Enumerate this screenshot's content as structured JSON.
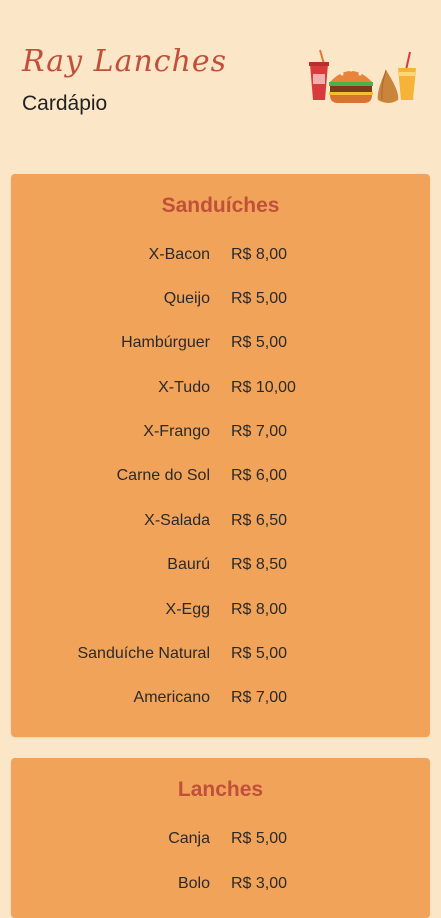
{
  "header": {
    "title": "Ray Lanches",
    "subtitle": "Cardápio",
    "logo_icon": "snack-food-icon"
  },
  "sections": [
    {
      "title": "Sanduíches",
      "items": [
        {
          "name": "X-Bacon",
          "price": "R$ 8,00"
        },
        {
          "name": "Queijo",
          "price": "R$ 5,00"
        },
        {
          "name": "Hambúrguer",
          "price": "R$ 5,00"
        },
        {
          "name": "X-Tudo",
          "price": "R$ 10,00"
        },
        {
          "name": "X-Frango",
          "price": "R$ 7,00"
        },
        {
          "name": "Carne do Sol",
          "price": "R$ 6,00"
        },
        {
          "name": "X-Salada",
          "price": "R$ 6,50"
        },
        {
          "name": "Baurú",
          "price": "R$ 8,50"
        },
        {
          "name": "X-Egg",
          "price": "R$ 8,00"
        },
        {
          "name": "Sanduíche Natural",
          "price": "R$ 5,00"
        },
        {
          "name": "Americano",
          "price": "R$ 7,00"
        }
      ]
    },
    {
      "title": "Lanches",
      "items": [
        {
          "name": "Canja",
          "price": "R$ 5,00"
        },
        {
          "name": "Bolo",
          "price": "R$ 3,00"
        }
      ]
    }
  ],
  "colors": {
    "background": "#fbe6c8",
    "card": "#f1a35a",
    "accent": "#c0503a"
  }
}
